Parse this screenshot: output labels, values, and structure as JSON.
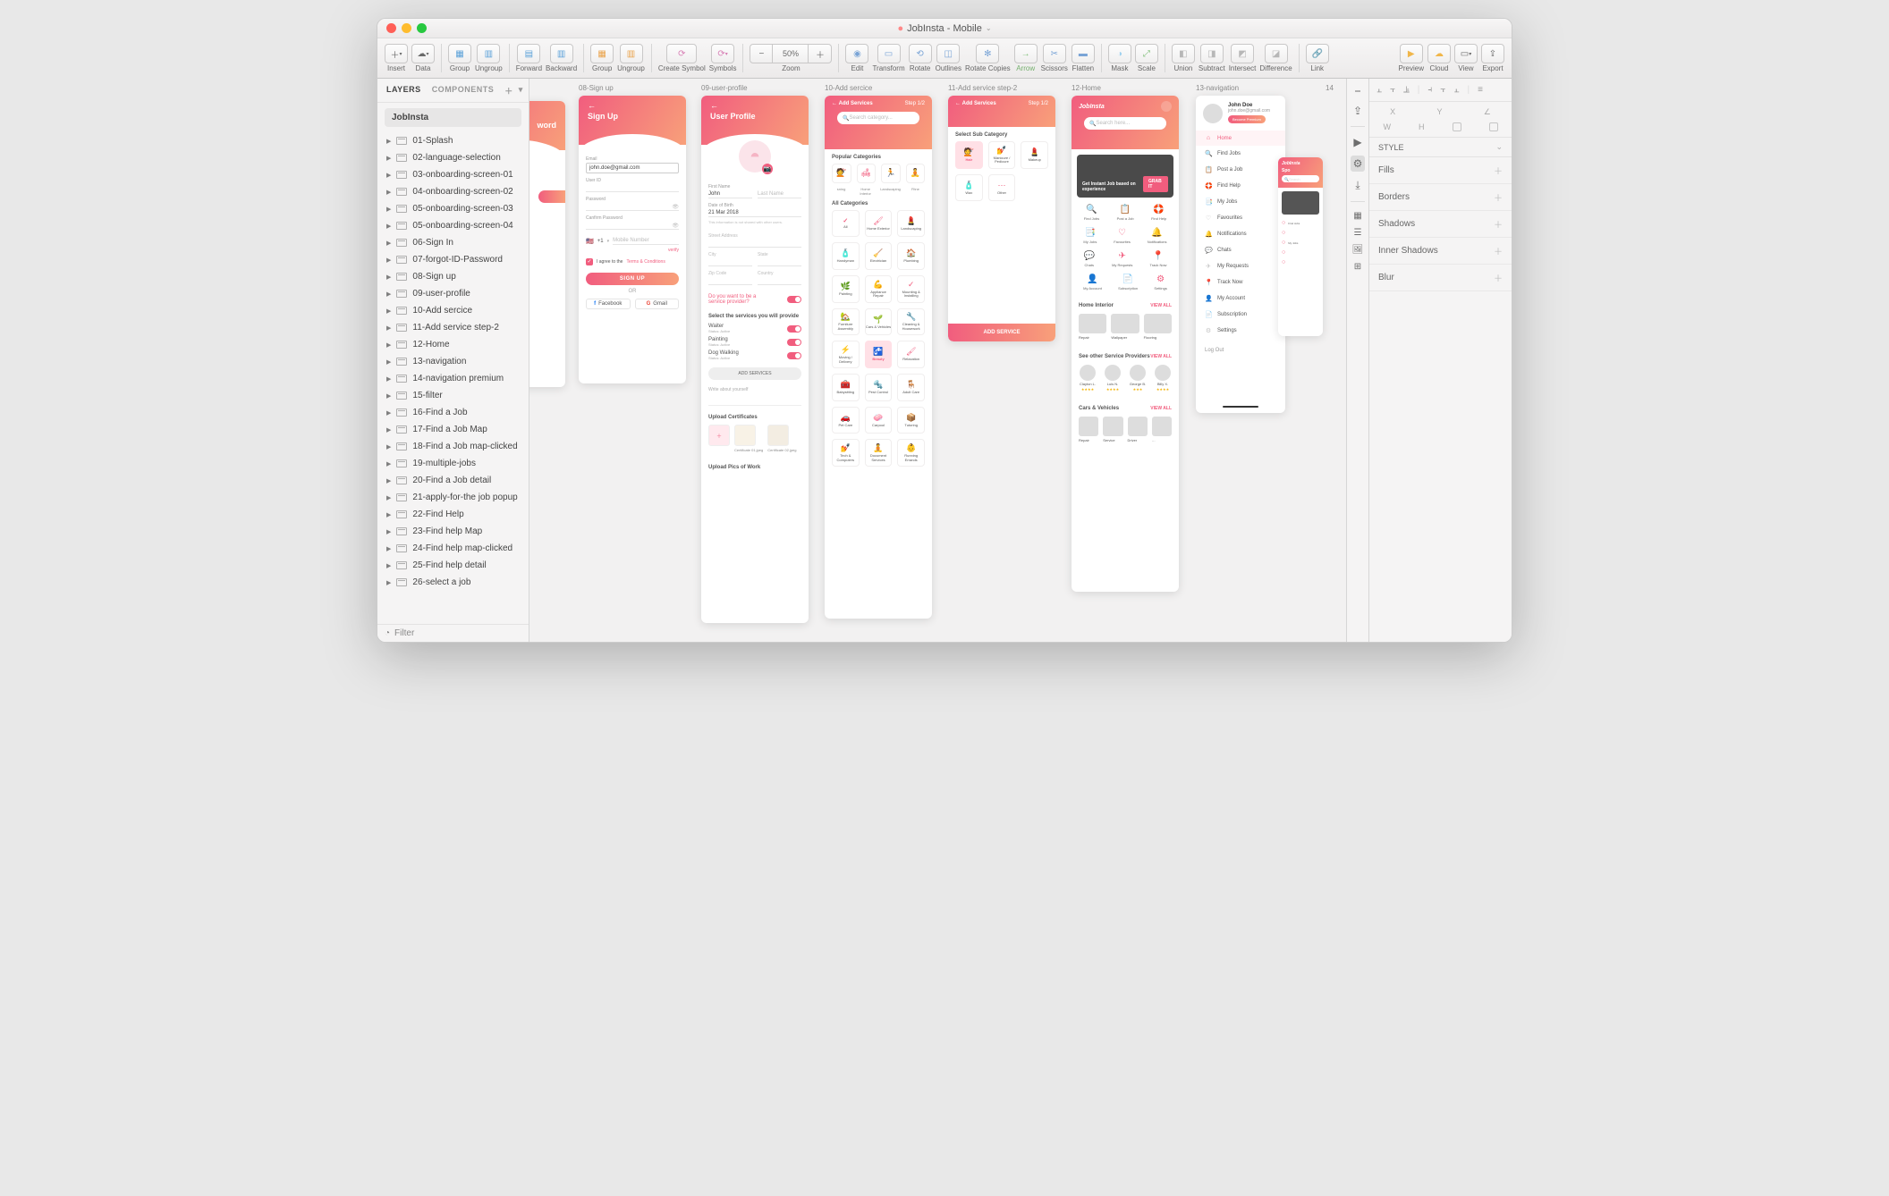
{
  "title": "JobInsta - Mobile",
  "toolbar": {
    "insert": "Insert",
    "data": "Data",
    "group": "Group",
    "ungroup": "Ungroup",
    "forward": "Forward",
    "backward": "Backward",
    "group2": "Group",
    "ungroup2": "Ungroup",
    "createSymbol": "Create Symbol",
    "symbols": "Symbols",
    "zoom_val": "50%",
    "zoom": "Zoom",
    "edit": "Edit",
    "transform": "Transform",
    "rotate": "Rotate",
    "outlines": "Outlines",
    "rotateCopies": "Rotate Copies",
    "arrow": "Arrow",
    "scissors": "Scissors",
    "flatten": "Flatten",
    "mask": "Mask",
    "scale": "Scale",
    "union": "Union",
    "subtract": "Subtract",
    "intersect": "Intersect",
    "difference": "Difference",
    "link": "Link",
    "preview": "Preview",
    "cloud": "Cloud",
    "view": "View",
    "export": "Export"
  },
  "sidebar": {
    "tab_layers": "LAYERS",
    "tab_components": "COMPONENTS",
    "page": "JobInsta",
    "filter": "Filter",
    "layers": [
      "01-Splash",
      "02-language-selection",
      "03-onboarding-screen-01",
      "04-onboarding-screen-02",
      "05-onboarding-screen-03",
      "05-onboarding-screen-04",
      "06-Sign In",
      "07-forgot-ID-Password",
      "08-Sign up",
      "09-user-profile",
      "10-Add sercice",
      "11-Add service step-2",
      "12-Home",
      "13-navigation",
      "14-navigation premium",
      "15-filter",
      "16-Find a Job",
      "17-Find a Job Map",
      "18-Find a Job map-clicked",
      "19-multiple-jobs",
      "20-Find a Job detail",
      "21-apply-for-the job popup",
      "22-Find Help",
      "23-Find help Map",
      "24-Find help map-clicked",
      "25-Find help detail",
      "26-select a job"
    ]
  },
  "inspector": {
    "style": "STYLE",
    "panels": [
      "Fills",
      "Borders",
      "Shadows",
      "Inner Shadows",
      "Blur"
    ]
  },
  "artboards": {
    "a07_word": "word",
    "a08": {
      "label": "08-Sign up",
      "title": "Sign Up",
      "email_lbl": "Email",
      "email": "john.doe@gmail.com",
      "uid": "User ID",
      "pw": "Password",
      "cpw": "Canfirm Password",
      "phone_cc": "+1",
      "phone": "Mobile Number",
      "verify": "verify",
      "agree1": "I agree to the ",
      "agree2": "Terms & Conditions",
      "btn": "SIGN UP",
      "or": "OR",
      "fb": "Facebook",
      "gm": "Gmail"
    },
    "a09": {
      "label": "09-user-profile",
      "title": "User Profile",
      "fn": "First Name",
      "fn_v": "John",
      "ln": "Last Name",
      "dob": "Date of Birth",
      "dob_v": "21 Mar 2018",
      "note": "This information is not shared with other users.",
      "addr": "Street Address",
      "city": "City",
      "state": "State",
      "zip": "Zip Code",
      "country": "Country",
      "q": "Do you want to be a service provider?",
      "sel_hdr": "Select the services you will provide",
      "s1_n": "Waiter",
      "s1_s": "Status: Active",
      "s2_n": "Painting",
      "s2_s": "Status: Active",
      "s3_n": "Dog Walking",
      "s3_s": "Status: Active",
      "addbtn": "ADD SERVICES",
      "about": "Write about yourself",
      "cert_hdr": "Upload Certificates",
      "cert1": "Certificate 01.jpeg",
      "cert2": "Certificate 02.jpeg",
      "pics": "Upload Pics of Work"
    },
    "a10": {
      "label": "10-Add sercice",
      "title": "Add Services",
      "step": "Step 1/2",
      "search": "Search category...",
      "pop": "Popular Categories",
      "pop_items_top": [
        "",
        "",
        "",
        ""
      ],
      "pop_items_bot": [
        "sning",
        "Home Interior",
        "Landscaping",
        "Fitne"
      ],
      "all_hdr": "All Categories",
      "all": [
        "All",
        "Home Exterior",
        "Landscaping",
        "Handyman",
        "Electrician",
        "Plumbing",
        "Painting",
        "Appliance Repair",
        "Mounting & Installing",
        "Furniture Assembly",
        "Cars & Vehicles",
        "Cleaning & Housework",
        "Moving / Delivery",
        "Beauty",
        "Relaxation",
        "Babysitting",
        "Pest Control",
        "Adult Care",
        "Pet Care",
        "Carpool",
        "Tutoring",
        "Tech & Computers",
        "Document Services",
        "Running Errands"
      ]
    },
    "a11": {
      "label": "11-Add service step-2",
      "title": "Add Services",
      "step": "Step 1/2",
      "sub": "Select Sub Category",
      "items": [
        "Hair",
        "Manicure / Pedicure",
        "Makeup",
        "Wax",
        "Other"
      ],
      "btn": "ADD SERVICE"
    },
    "a12": {
      "label": "12-Home",
      "brand": "JobInsta",
      "search": "Search here...",
      "hero_t": "Get Instant Job based on experience",
      "hero_b": "GRAB IT",
      "acts1": [
        "Find Jobs",
        "Post a Job",
        "Find Help"
      ],
      "acts2": [
        "My Jobs",
        "Favourites",
        "Notifications"
      ],
      "acts3": [
        "Chats",
        "My Requests",
        "Track Now"
      ],
      "acts4": [
        "My Account",
        "Subscription",
        "Settings"
      ],
      "hi": "Home Interior",
      "see": "VIEW ALL",
      "hi_items": [
        "Repair",
        "Wallpaper",
        "Flooring"
      ],
      "sp_hdr": "See other Service Providers",
      "sp": [
        {
          "n": "Clayton L.",
          "s": "★★★★"
        },
        {
          "n": "Luis N.",
          "s": "★★★★"
        },
        {
          "n": "George B.",
          "s": "★★★"
        },
        {
          "n": "Billy X.",
          "s": "★★★★"
        }
      ],
      "cv": "Cars & Vehicles",
      "cv_items": [
        "Repair",
        "Service",
        "Driver",
        "…"
      ]
    },
    "a13": {
      "label": "13-navigation",
      "name": "John Doe",
      "email": "john.doe@gmail.com",
      "prem": "Become Premium",
      "rows": [
        "Home",
        "Find Jobs",
        "Post a Job",
        "Find Help",
        "My Jobs",
        "Favourites",
        "Notifications",
        "Chats",
        "My Requests",
        "Track Now",
        "My Account",
        "Subscription",
        "Settings"
      ],
      "logout": "Log Out"
    },
    "a14_label": "14",
    "a14_mini": {
      "brand": "JobInsta",
      "sp": "Spo",
      "search": "Search",
      "acts": [
        "Find Jobs",
        "",
        "My Jobs",
        "",
        ""
      ]
    }
  }
}
